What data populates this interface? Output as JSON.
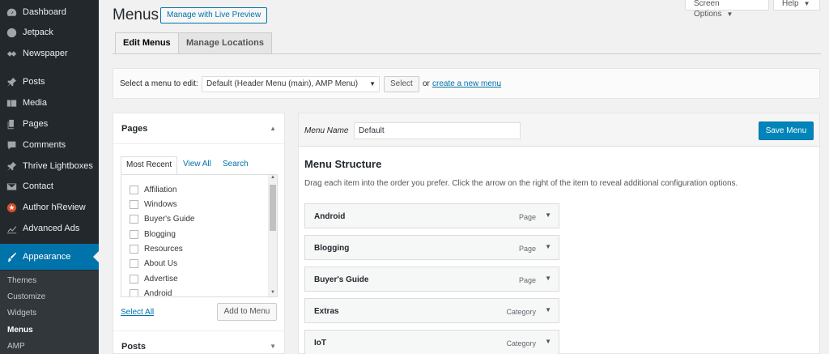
{
  "sidebar": {
    "items": [
      {
        "label": "Dashboard",
        "icon": "dashboard-icon"
      },
      {
        "label": "Jetpack",
        "icon": "jetpack-icon"
      },
      {
        "label": "Newspaper",
        "icon": "newspaper-icon"
      },
      {
        "label": "Posts",
        "icon": "pin-icon"
      },
      {
        "label": "Media",
        "icon": "media-icon"
      },
      {
        "label": "Pages",
        "icon": "pages-icon"
      },
      {
        "label": "Comments",
        "icon": "comments-icon"
      },
      {
        "label": "Thrive Lightboxes",
        "icon": "pin-icon"
      },
      {
        "label": "Contact",
        "icon": "mail-icon"
      },
      {
        "label": "Author hReview",
        "icon": "star-icon"
      },
      {
        "label": "Advanced Ads",
        "icon": "chart-icon"
      },
      {
        "label": "Appearance",
        "icon": "brush-icon"
      }
    ],
    "submenu": [
      "Themes",
      "Customize",
      "Widgets",
      "Menus",
      "AMP"
    ]
  },
  "header": {
    "title": "Menus",
    "live_preview": "Manage with Live Preview",
    "screen_options": "Screen Options",
    "help": "Help"
  },
  "tabs": {
    "edit": "Edit Menus",
    "locations": "Manage Locations"
  },
  "manage": {
    "label": "Select a menu to edit:",
    "selected": "Default (Header Menu (main), AMP Menu)",
    "select_button": "Select",
    "or": "or",
    "create_link": "create a new menu",
    "period": "."
  },
  "left": {
    "pages_title": "Pages",
    "tabs": [
      "Most Recent",
      "View All",
      "Search"
    ],
    "pages": [
      "Affiliation",
      "Windows",
      "Buyer's Guide",
      "Blogging",
      "Resources",
      "About Us",
      "Advertise",
      "Android"
    ],
    "select_all": "Select All",
    "add_to_menu": "Add to Menu",
    "posts_title": "Posts"
  },
  "right": {
    "menu_name_label": "Menu Name",
    "menu_name_value": "Default",
    "save": "Save Menu",
    "structure_title": "Menu Structure",
    "structure_desc": "Drag each item into the order you prefer. Click the arrow on the right of the item to reveal additional configuration options.",
    "items": [
      {
        "title": "Android",
        "type": "Page"
      },
      {
        "title": "Blogging",
        "type": "Page"
      },
      {
        "title": "Buyer's Guide",
        "type": "Page"
      },
      {
        "title": "Extras",
        "type": "Category"
      },
      {
        "title": "IoT",
        "type": "Category"
      }
    ]
  },
  "colors": {
    "sidebar": "#23282d",
    "active": "#0073aa",
    "primary_button": "#0085ba"
  }
}
